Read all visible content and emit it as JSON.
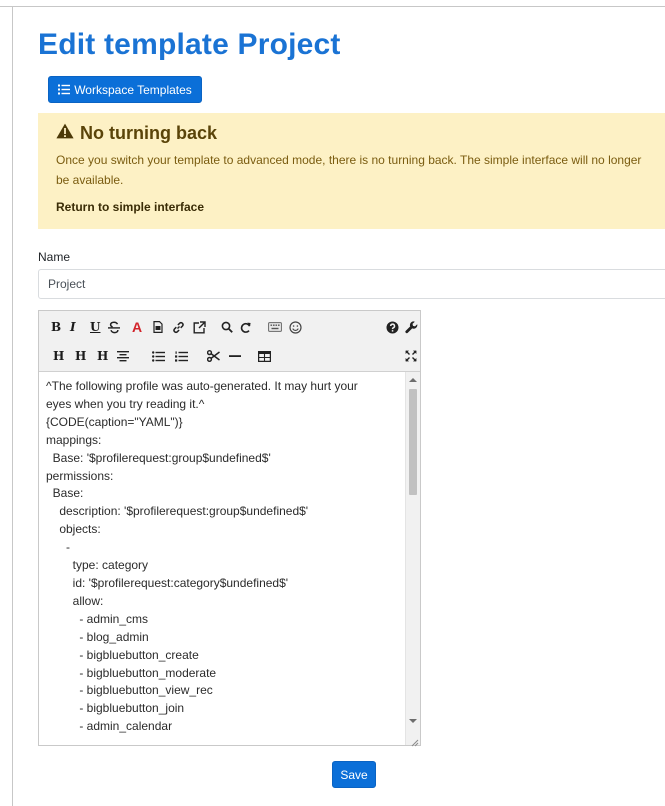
{
  "page": {
    "title": "Edit template Project"
  },
  "toolbar": {
    "workspace_templates_label": "Workspace Templates"
  },
  "alert": {
    "title": "No turning back",
    "body": "Once you switch your template to advanced mode, there is no turning back. The simple interface will no longer be available.",
    "link": "Return to simple interface"
  },
  "form": {
    "name_label": "Name",
    "name_value": "Project",
    "save_label": "Save"
  },
  "editor": {
    "toolbar_row1": [
      "bold",
      "italic",
      "underline",
      "strikethrough",
      "color",
      "image",
      "link",
      "external-link",
      "find",
      "undo",
      "keyboard",
      "smiley",
      "help",
      "admin"
    ],
    "toolbar_row2": [
      "H",
      "H",
      "H",
      "center-align",
      "bullet-list",
      "numbered-list",
      "cut",
      "horizontal-rule",
      "table",
      "fullscreen"
    ],
    "lines": [
      "^The following profile was auto-generated. It may hurt your",
      "eyes when you try reading it.^",
      "{CODE(caption=\"YAML\")}",
      "mappings:",
      "  Base: '$profilerequest:group$undefined$'",
      "permissions:",
      "  Base:",
      "    description: '$profilerequest:group$undefined$'",
      "    objects:",
      "      -",
      "        type: category",
      "        id: '$profilerequest:category$undefined$'",
      "        allow:",
      "          - admin_cms",
      "          - blog_admin",
      "          - bigbluebutton_create",
      "          - bigbluebutton_moderate",
      "          - bigbluebutton_view_rec",
      "          - bigbluebutton_join",
      "          - admin_calendar"
    ]
  },
  "colors": {
    "primary": "#0b6fd8",
    "title": "#1a73d4",
    "warning_bg": "#fdf1c5",
    "warning_text": "#7a5c10"
  }
}
